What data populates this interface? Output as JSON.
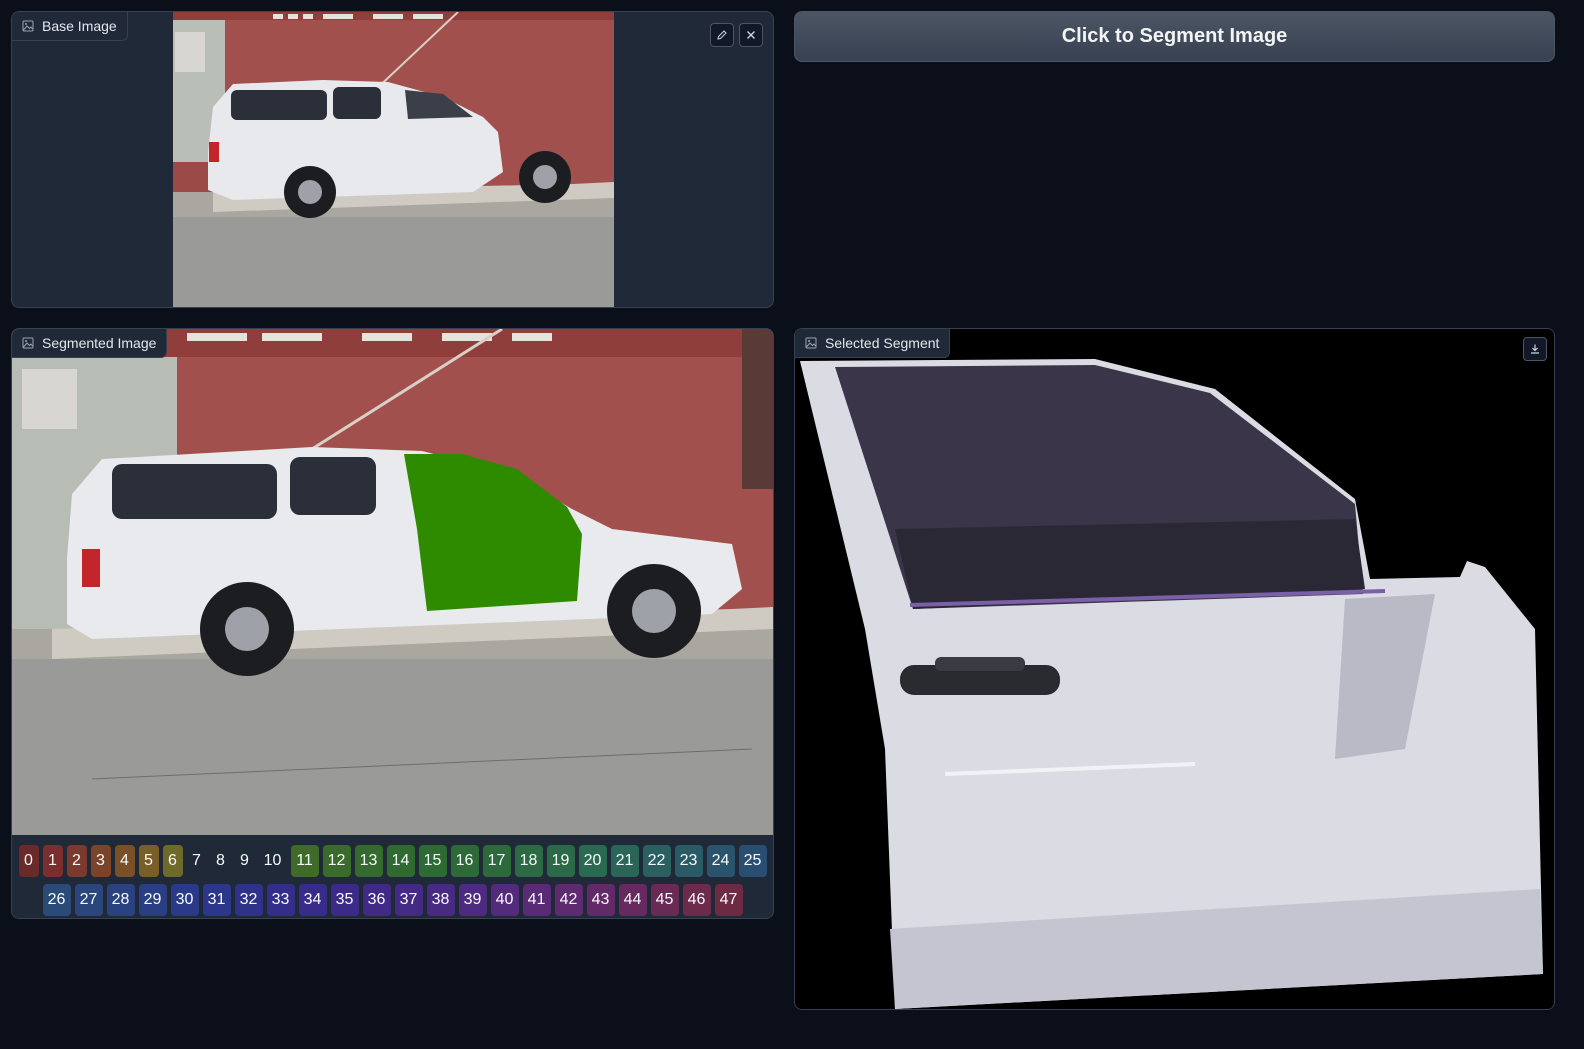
{
  "base_image": {
    "label": "Base Image",
    "icons": [
      "image-icon",
      "pencil-icon",
      "close-icon"
    ]
  },
  "segment_button": {
    "label": "Click to Segment Image"
  },
  "segmented_image": {
    "label": "Segmented Image",
    "highlight_color": "#2e8b00",
    "legend_row1": [
      {
        "n": "0",
        "c": "#6b2a2a"
      },
      {
        "n": "1",
        "c": "#7a2e2e"
      },
      {
        "n": "2",
        "c": "#7a3a2c"
      },
      {
        "n": "3",
        "c": "#7a432a"
      },
      {
        "n": "4",
        "c": "#7a5028"
      },
      {
        "n": "5",
        "c": "#7a5e28"
      },
      {
        "n": "6",
        "c": "#6e6a2a"
      },
      {
        "n": "7",
        "c": "#1f2937"
      },
      {
        "n": "8",
        "c": "#1f2937"
      },
      {
        "n": "9",
        "c": "#1f2937"
      },
      {
        "n": "10",
        "c": "#1f2937"
      },
      {
        "n": "11",
        "c": "#3f6a2a"
      },
      {
        "n": "12",
        "c": "#3a6a2c"
      },
      {
        "n": "13",
        "c": "#356a2e"
      },
      {
        "n": "14",
        "c": "#2f6a30"
      },
      {
        "n": "15",
        "c": "#2e6a34"
      },
      {
        "n": "16",
        "c": "#2d6a38"
      },
      {
        "n": "17",
        "c": "#2c6a3c"
      },
      {
        "n": "18",
        "c": "#2b6a42"
      },
      {
        "n": "19",
        "c": "#2b6a48"
      },
      {
        "n": "20",
        "c": "#2a6a50"
      },
      {
        "n": "21",
        "c": "#2a6558"
      },
      {
        "n": "22",
        "c": "#2a6060"
      },
      {
        "n": "23",
        "c": "#2a5a66"
      },
      {
        "n": "24",
        "c": "#2a546c"
      },
      {
        "n": "25",
        "c": "#2a4e72"
      }
    ],
    "legend_row2": [
      {
        "n": "26",
        "c": "#2a4a78"
      },
      {
        "n": "27",
        "c": "#2a467c"
      },
      {
        "n": "28",
        "c": "#2a4280"
      },
      {
        "n": "29",
        "c": "#2a3e84"
      },
      {
        "n": "30",
        "c": "#2a3a88"
      },
      {
        "n": "31",
        "c": "#2c368a"
      },
      {
        "n": "32",
        "c": "#30328a"
      },
      {
        "n": "33",
        "c": "#342e8a"
      },
      {
        "n": "34",
        "c": "#382c8a"
      },
      {
        "n": "35",
        "c": "#3c2a88"
      },
      {
        "n": "36",
        "c": "#402a86"
      },
      {
        "n": "37",
        "c": "#442a84"
      },
      {
        "n": "38",
        "c": "#482a82"
      },
      {
        "n": "39",
        "c": "#4e2a80"
      },
      {
        "n": "40",
        "c": "#542a7c"
      },
      {
        "n": "41",
        "c": "#5a2a76"
      },
      {
        "n": "42",
        "c": "#5e2a70"
      },
      {
        "n": "43",
        "c": "#622a68"
      },
      {
        "n": "44",
        "c": "#662a60"
      },
      {
        "n": "45",
        "c": "#6a2a56"
      },
      {
        "n": "46",
        "c": "#6c2a4c"
      },
      {
        "n": "47",
        "c": "#6e2a42"
      }
    ]
  },
  "selected_segment": {
    "label": "Selected Segment",
    "icons": [
      "image-icon",
      "download-icon"
    ]
  }
}
